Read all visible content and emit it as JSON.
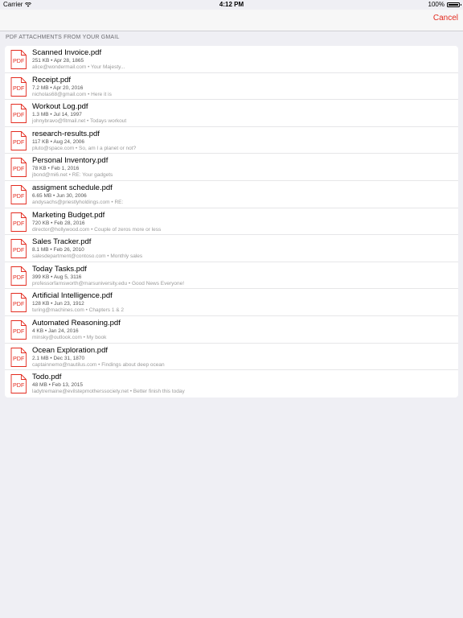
{
  "status_bar": {
    "carrier": "Carrier",
    "time": "4:12 PM",
    "battery": "100%"
  },
  "nav": {
    "cancel_label": "Cancel"
  },
  "section": {
    "header": "PDF ATTACHMENTS FROM YOUR GMAIL"
  },
  "colors": {
    "accent": "#e32a1e",
    "background": "#efeff4"
  },
  "icon": {
    "label": "PDF"
  },
  "attachments": [
    {
      "name": "Scanned Invoice.pdf",
      "meta": "251 KB • Apr 28, 1865",
      "from": "alice@wondermail.com • Your Majesty..."
    },
    {
      "name": "Receipt.pdf",
      "meta": "7.2 MB • Apr 20, 2016",
      "from": "nicholas68@gmail.com • Here it is"
    },
    {
      "name": "Workout Log.pdf",
      "meta": "1.3 MB • Jul 14, 1997",
      "from": "johnybravo@fitmail.net • Todays workout"
    },
    {
      "name": "research-results.pdf",
      "meta": "117 KB • Aug 24, 2006",
      "from": "pluto@space.com • So, am I a planet or not?"
    },
    {
      "name": "Personal Inventory.pdf",
      "meta": "78 KB • Feb 1, 2016",
      "from": "jbond@mi6.net • RE: Your gadgets"
    },
    {
      "name": "assigment schedule.pdf",
      "meta": "6.65 MB • Jun 30, 2006",
      "from": "andysachs@priestlyholdings.com • RE:"
    },
    {
      "name": "Marketing Budget.pdf",
      "meta": "720 KB • Feb 28, 2016",
      "from": "director@hollywood.com • Couple of zeros more or less"
    },
    {
      "name": "Sales Tracker.pdf",
      "meta": "8.1 MB • Feb 26, 2010",
      "from": "salesdepartment@contoso.com • Monthly sales"
    },
    {
      "name": "Today Tasks.pdf",
      "meta": "399 KB • Aug 5, 3116",
      "from": "professorfarnsworth@marsuniversity.edu • Good News Everyone!"
    },
    {
      "name": "Artificial Intelligence.pdf",
      "meta": "128 KB • Jun 23, 1912",
      "from": "turing@machines.com • Chapters 1 & 2"
    },
    {
      "name": "Automated Reasoning.pdf",
      "meta": "4 KB • Jan 24, 2016",
      "from": "minsky@outlook.com • My book"
    },
    {
      "name": "Ocean Exploration.pdf",
      "meta": "2.1 MB • Dec 31, 1870",
      "from": "captainnemo@nautilus.com • Findings about deep ocean"
    },
    {
      "name": "Todo.pdf",
      "meta": "48 MB • Feb 13, 2015",
      "from": "ladytremaine@evilstepmotherssociety.net • Better finish this today"
    }
  ]
}
